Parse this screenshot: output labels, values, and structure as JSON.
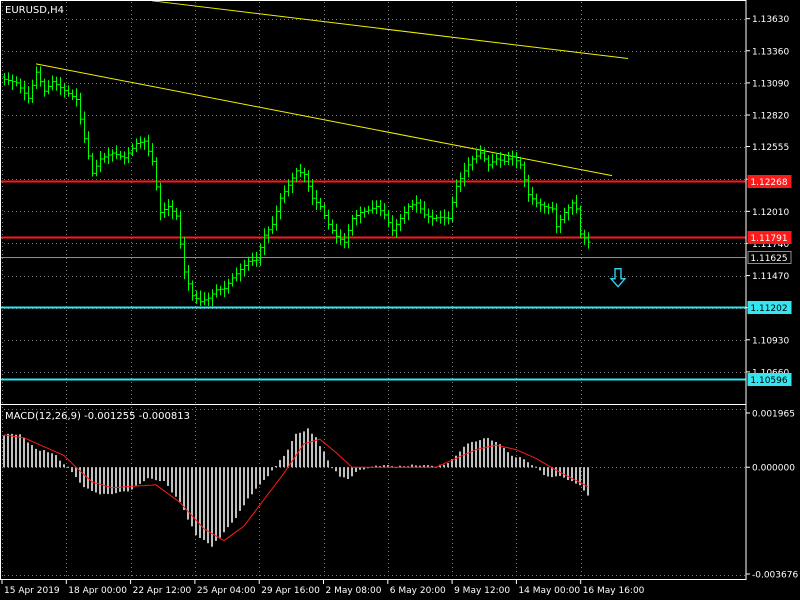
{
  "symbol_label": "EURUSD,H4",
  "macd_label": "MACD(12,26,9) -0.001255 -0.000813",
  "colors": {
    "background": "#000000",
    "grid": "#7a7a7a",
    "candle": "#00ff00",
    "trendline": "#f0f000",
    "resistance": "#ff1a1a",
    "support": "#33e6f0",
    "current_price_line": "#8c8c96",
    "histogram": "#c0c0c0",
    "signal_line": "#ff1a1a",
    "arrow": "#33ccf0"
  },
  "icons": {
    "sell_arrow": "down-arrow-icon"
  },
  "chart_data": [
    {
      "type": "candlestick",
      "ylim": [
        1.1039,
        1.1377
      ],
      "price_axis_ticks": [
        "1.13630",
        "1.13360",
        "1.13090",
        "1.12820",
        "1.12555",
        "1.12280",
        "1.12010",
        "1.11740",
        "1.11470",
        "1.11200",
        "1.10930",
        "1.10660"
      ],
      "price_axis_tick_values": [
        1.1363,
        1.1336,
        1.1309,
        1.1282,
        1.12555,
        1.1228,
        1.1201,
        1.1174,
        1.1147,
        1.112,
        1.1093,
        1.1066
      ],
      "time_axis_ticks": [
        "15 Apr 2019",
        "18 Apr 00:00",
        "22 Apr 12:00",
        "25 Apr 04:00",
        "29 Apr 16:00",
        "2 May 08:00",
        "6 May 20:00",
        "9 May 12:00",
        "14 May 00:00",
        "16 May 16:00"
      ],
      "bar_count": 147,
      "horizontal_levels": [
        {
          "kind": "resistance",
          "value": 1.12268,
          "label": "1.12268"
        },
        {
          "kind": "resistance",
          "value": 1.11791,
          "label": "1.11791"
        },
        {
          "kind": "current",
          "value": 1.11625,
          "label": "1.11625"
        },
        {
          "kind": "support",
          "value": 1.11202,
          "label": "1.11202"
        },
        {
          "kind": "support",
          "value": 1.10596,
          "label": "1.10596"
        }
      ],
      "trendlines": [
        {
          "from": {
            "bar": 37,
            "price": 1.1378
          },
          "to": {
            "bar": 156,
            "price": 1.13295
          }
        },
        {
          "from": {
            "bar": 8,
            "price": 1.1325
          },
          "to": {
            "bar": 152,
            "price": 1.1231
          }
        }
      ],
      "anchors": [
        [
          0,
          1.1312
        ],
        [
          3,
          1.1309
        ],
        [
          6,
          1.1296
        ],
        [
          8,
          1.1318
        ],
        [
          10,
          1.1302
        ],
        [
          12,
          1.131
        ],
        [
          14,
          1.1305
        ],
        [
          16,
          1.13
        ],
        [
          18,
          1.1295
        ],
        [
          20,
          1.1262
        ],
        [
          22,
          1.1233
        ],
        [
          24,
          1.1245
        ],
        [
          27,
          1.125
        ],
        [
          30,
          1.1246
        ],
        [
          33,
          1.1258
        ],
        [
          35,
          1.126
        ],
        [
          37,
          1.1243
        ],
        [
          39,
          1.12
        ],
        [
          41,
          1.1205
        ],
        [
          43,
          1.1197
        ],
        [
          45,
          1.115
        ],
        [
          47,
          1.113
        ],
        [
          49,
          1.1125
        ],
        [
          51,
          1.1128
        ],
        [
          53,
          1.1135
        ],
        [
          55,
          1.1136
        ],
        [
          57,
          1.1145
        ],
        [
          59,
          1.1152
        ],
        [
          61,
          1.1159
        ],
        [
          63,
          1.116
        ],
        [
          65,
          1.1181
        ],
        [
          67,
          1.119
        ],
        [
          69,
          1.1212
        ],
        [
          71,
          1.1223
        ],
        [
          73,
          1.1235
        ],
        [
          75,
          1.1232
        ],
        [
          77,
          1.1212
        ],
        [
          79,
          1.1205
        ],
        [
          81,
          1.119
        ],
        [
          83,
          1.118
        ],
        [
          85,
          1.1175
        ],
        [
          87,
          1.1195
        ],
        [
          89,
          1.12
        ],
        [
          91,
          1.1202
        ],
        [
          93,
          1.1205
        ],
        [
          95,
          1.1198
        ],
        [
          97,
          1.1185
        ],
        [
          99,
          1.1195
        ],
        [
          101,
          1.1205
        ],
        [
          103,
          1.1208
        ],
        [
          105,
          1.1198
        ],
        [
          107,
          1.1195
        ],
        [
          109,
          1.1196
        ],
        [
          111,
          1.1195
        ],
        [
          113,
          1.1222
        ],
        [
          115,
          1.1235
        ],
        [
          117,
          1.1245
        ],
        [
          119,
          1.125
        ],
        [
          121,
          1.124
        ],
        [
          123,
          1.1245
        ],
        [
          125,
          1.1243
        ],
        [
          127,
          1.1247
        ],
        [
          129,
          1.124
        ],
        [
          131,
          1.1215
        ],
        [
          133,
          1.1208
        ],
        [
          135,
          1.1205
        ],
        [
          137,
          1.1203
        ],
        [
          138,
          1.1188
        ],
        [
          140,
          1.12
        ],
        [
          142,
          1.1208
        ],
        [
          143,
          1.1203
        ],
        [
          144,
          1.1182
        ],
        [
          146,
          1.1175
        ],
        [
          147,
          1.117
        ],
        [
          148,
          1.1168
        ],
        [
          149,
          1.116
        ]
      ]
    },
    {
      "type": "bar",
      "name": "MACD(12,26,9)",
      "macd_value": -0.001255,
      "signal_value": -0.000813,
      "ylim": [
        -0.00384,
        0.00205
      ],
      "axis_ticks": [
        "0.001965",
        "0.000000",
        "-0.003676"
      ],
      "axis_tick_values": [
        0.001965,
        0.0,
        -0.003676
      ],
      "histogram_anchors": [
        [
          0,
          0.0011
        ],
        [
          4,
          0.00115
        ],
        [
          8,
          0.0006
        ],
        [
          12,
          0.0005
        ],
        [
          16,
          0.0
        ],
        [
          20,
          -0.0007
        ],
        [
          24,
          -0.0009
        ],
        [
          28,
          -0.0009
        ],
        [
          32,
          -0.00075
        ],
        [
          36,
          -0.0004
        ],
        [
          40,
          -0.0005
        ],
        [
          44,
          -0.0012
        ],
        [
          48,
          -0.0023
        ],
        [
          52,
          -0.0027
        ],
        [
          55,
          -0.0022
        ],
        [
          58,
          -0.0017
        ],
        [
          62,
          -0.0009
        ],
        [
          66,
          -0.0003
        ],
        [
          70,
          0.0004
        ],
        [
          73,
          0.0011
        ],
        [
          76,
          0.0013
        ],
        [
          78,
          0.001
        ],
        [
          80,
          0.0005
        ],
        [
          82,
          0.0
        ],
        [
          84,
          -0.00035
        ],
        [
          86,
          -0.0004
        ],
        [
          88,
          -0.00015
        ],
        [
          90,
          -5e-05
        ],
        [
          92,
          0.0
        ],
        [
          94,
          5e-05
        ],
        [
          98,
          2e-05
        ],
        [
          102,
          5e-05
        ],
        [
          106,
          5e-05
        ],
        [
          110,
          5e-05
        ],
        [
          113,
          0.0004
        ],
        [
          116,
          0.0008
        ],
        [
          119,
          0.00095
        ],
        [
          121,
          0.001
        ],
        [
          124,
          0.0008
        ],
        [
          127,
          0.0004
        ],
        [
          130,
          0.0003
        ],
        [
          133,
          0.0
        ],
        [
          135,
          -0.0003
        ],
        [
          137,
          -0.0003
        ],
        [
          140,
          -0.00035
        ],
        [
          144,
          -0.0006
        ],
        [
          146,
          -0.001
        ],
        [
          148,
          -0.00125
        ]
      ],
      "signal_anchors": [
        [
          0,
          0.0011
        ],
        [
          5,
          0.001
        ],
        [
          10,
          0.0007
        ],
        [
          15,
          0.0004
        ],
        [
          18,
          0.0
        ],
        [
          22,
          -0.0005
        ],
        [
          27,
          -0.0007
        ],
        [
          32,
          -0.00065
        ],
        [
          38,
          -0.0006
        ],
        [
          44,
          -0.0012
        ],
        [
          50,
          -0.0021
        ],
        [
          55,
          -0.0025
        ],
        [
          60,
          -0.002
        ],
        [
          65,
          -0.0011
        ],
        [
          70,
          -0.0002
        ],
        [
          75,
          0.0008
        ],
        [
          79,
          0.00095
        ],
        [
          83,
          0.0005
        ],
        [
          87,
          0.0
        ],
        [
          92,
          0.0
        ],
        [
          100,
          0.0
        ],
        [
          108,
          0.0
        ],
        [
          113,
          0.0003
        ],
        [
          118,
          0.0006
        ],
        [
          123,
          0.00075
        ],
        [
          128,
          0.0006
        ],
        [
          133,
          0.0003
        ],
        [
          138,
          -0.0001
        ],
        [
          143,
          -0.00045
        ],
        [
          148,
          -0.00081
        ]
      ]
    }
  ]
}
